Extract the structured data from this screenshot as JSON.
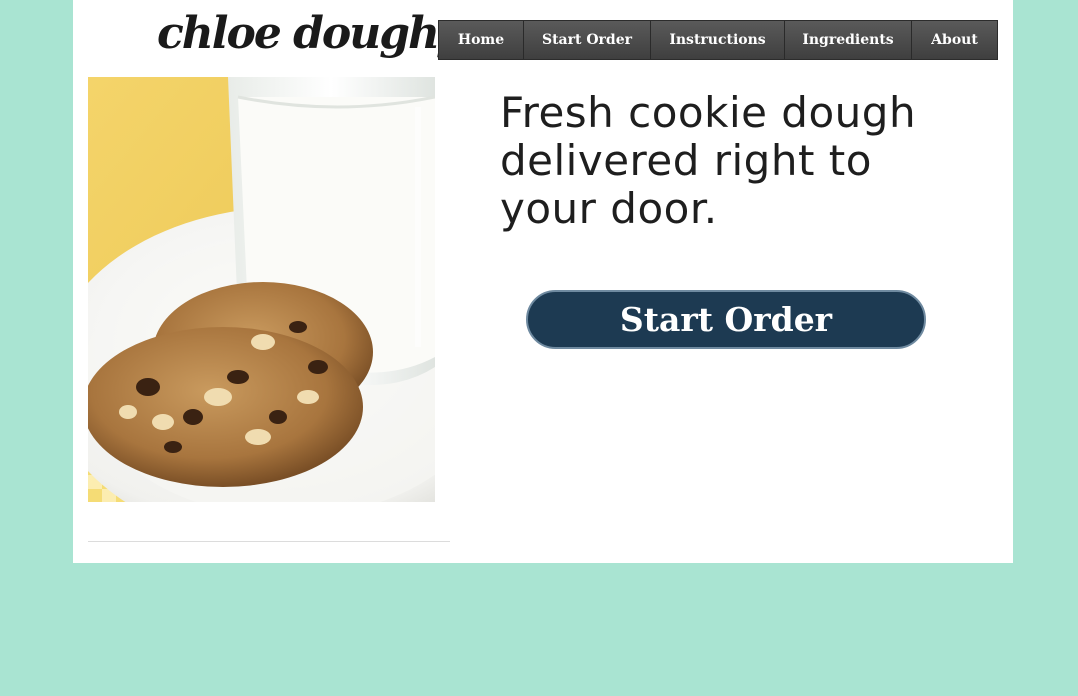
{
  "brand": {
    "logo_text": "chloe doughy"
  },
  "nav": {
    "items": [
      {
        "label": "Home"
      },
      {
        "label": "Start Order"
      },
      {
        "label": "Instructions"
      },
      {
        "label": "Ingredients"
      },
      {
        "label": "About"
      }
    ]
  },
  "hero": {
    "headline": "Fresh cookie dough delivered right to your door.",
    "cta_label": "Start Order",
    "image_subject": "cookies-and-milk-photo"
  },
  "colors": {
    "page_background": "#a9e4d2",
    "content_background": "#ffffff",
    "nav_background": "#4a4a4a",
    "cta_background": "#1d3a52",
    "photo_backdrop": "#f1cf5c"
  }
}
